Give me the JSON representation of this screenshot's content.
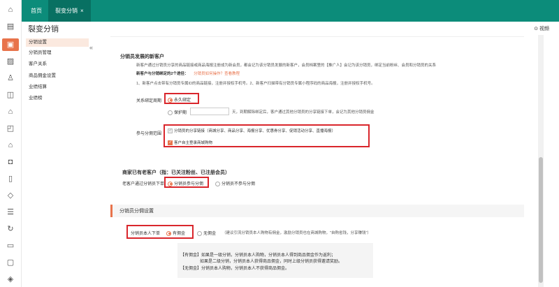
{
  "sidebar_icons": [
    "home-icon",
    "store-icon",
    "document-icon",
    "image-icon",
    "user-icon",
    "chart-icon",
    "house-icon",
    "bag-icon",
    "building-icon",
    "lock-icon",
    "clipboard-icon",
    "box-icon",
    "list-icon",
    "refresh-icon",
    "note-icon",
    "tv-icon",
    "tag-icon"
  ],
  "tabs": {
    "home": "首页",
    "current": "裂变分销",
    "close": "×"
  },
  "page": {
    "title": "裂变分销",
    "video": "⊙ 视频"
  },
  "subnav": {
    "collapse": "«",
    "items": [
      "分销设置",
      "分销员管理",
      "客户关系",
      "商品佣金设置",
      "业绩结算",
      "业绩榜"
    ]
  },
  "section1": {
    "title": "分销员发展的新客户",
    "desc": "新客户通过分销员分享的商品链接或商品海报注册成为新会员，都会记为该分销员发展的新客户，会员档案里的【推广人】会记为该分销员，绑定当前粉丝、会员和分销员的关系",
    "bind_title": "新客户与分销绑定的2个途径：",
    "bind_link": "分销员如何操作？查看教程",
    "bind_steps": "1、新客户点击带有分销员专属ID的商品链接，注册并授权手机号。2、新客户扫描带有分销员专属小程序码的商品海报，注册并授权手机号。",
    "period_label": "关系绑定周期",
    "period_forever": "永久绑定",
    "period_protect": "保护期",
    "period_protect_hint": "天，到期解除绑定后，客户通过其他分销员的分享链接下单，会记为其他分销员佣金",
    "scope_label": "参与分佣范围",
    "scope_share": "分销员的分享链接（商城分享、商品分享、海报分享、优惠券分享、促销活动分享、直播海报）",
    "scope_self": "客户自主登录商城购物"
  },
  "section2": {
    "title": "商家已有老客户（指：已关注粉丝、已注册会员）",
    "label": "老客户通过分销员下单",
    "opt_yes": "分销员参与分佣",
    "opt_no": "分销员不参与分佣"
  },
  "section3": {
    "title": "分销员分佣设置",
    "label": "分销员本人下单",
    "opt_yes": "有佣金",
    "opt_no": "无佣金",
    "opt_no_hint": "（建议引流分销员本人购物有佣金，激励分销员也在商城购物，\"自购省钱，分享赚钱\"）",
    "info": [
      "【有佣金】如果是一级分销，分销员本人购物，分销员本人得到商品佣金作为返利；",
      "如果是二级分销，分销员本人获得商品佣金，同时上级分销员获得邀请奖励。",
      "【无佣金】分销员本人购物，分销员本人不获得商品佣金。"
    ]
  },
  "colors": {
    "accent": "#e8734b",
    "topbar": "#0c8c7a",
    "highlight": "#d9262c"
  }
}
